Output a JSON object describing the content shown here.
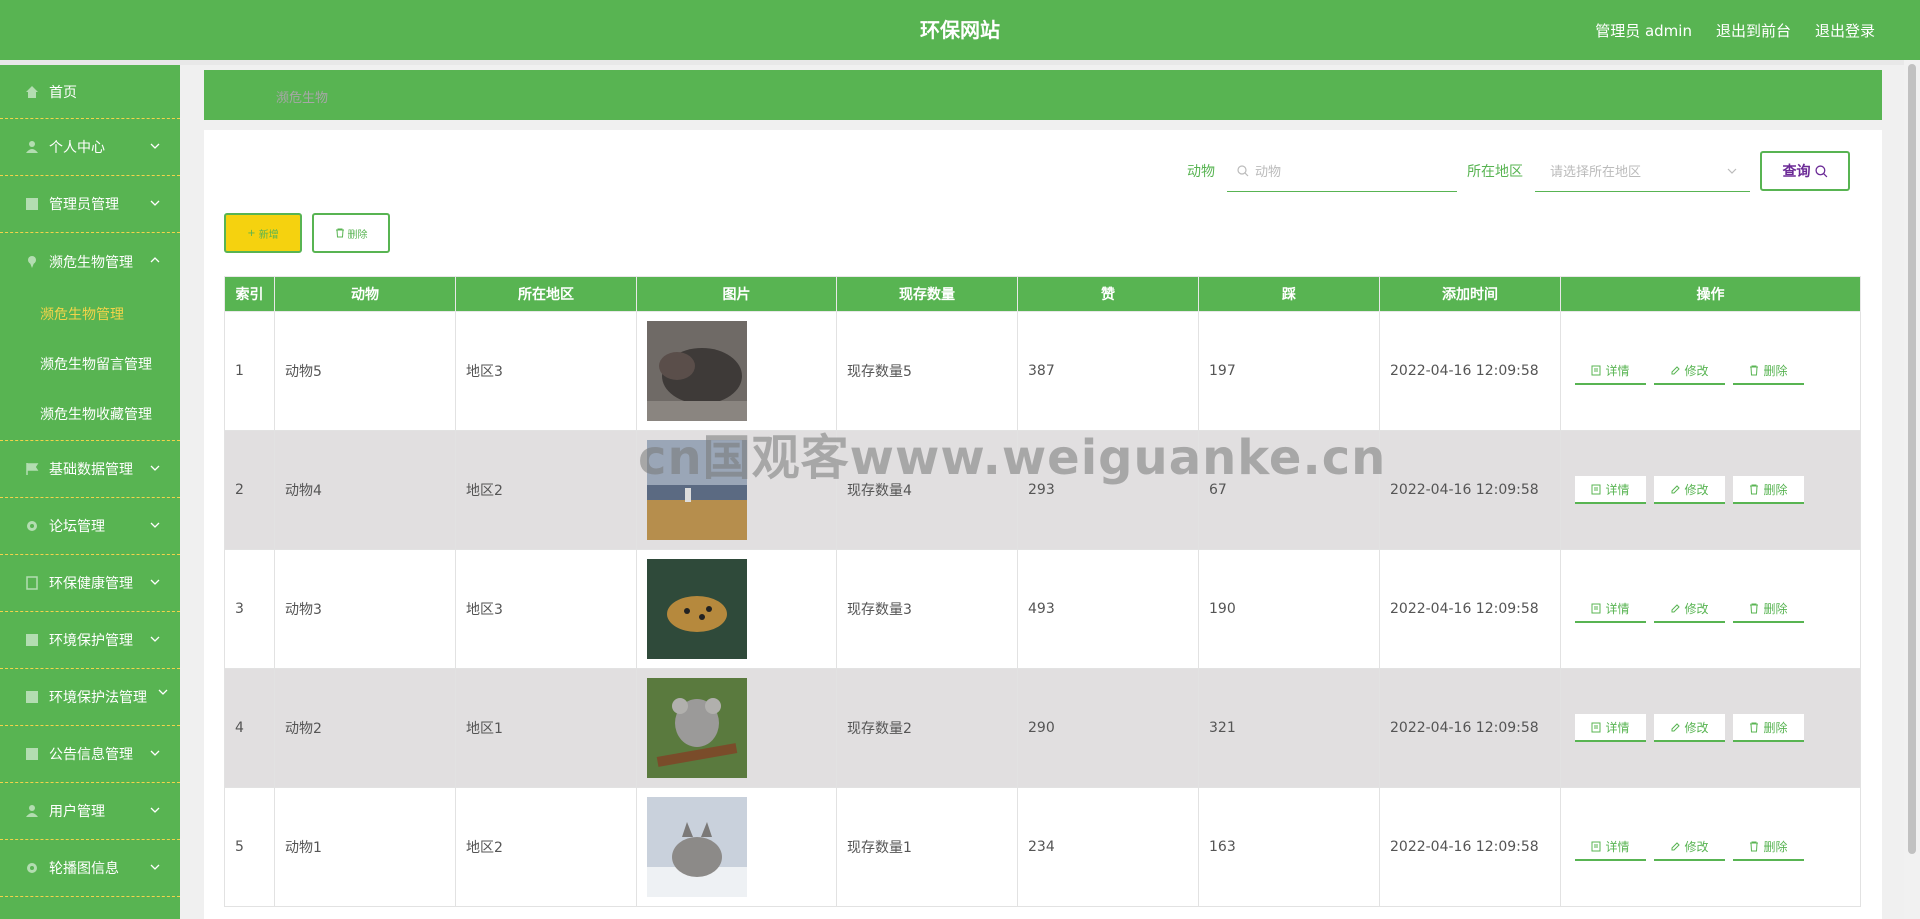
{
  "header": {
    "title": "环保网站",
    "admin_label": "管理员 admin",
    "to_front": "退出到前台",
    "logout": "退出登录"
  },
  "sidebar": {
    "items": [
      {
        "label": "首页",
        "icon": "home-icon"
      },
      {
        "label": "个人中心",
        "icon": "user-icon"
      },
      {
        "label": "管理员管理",
        "icon": "grid-icon"
      },
      {
        "label": "濒危生物管理",
        "icon": "pin-icon"
      },
      {
        "label": "基础数据管理",
        "icon": "flag-icon"
      },
      {
        "label": "论坛管理",
        "icon": "gear-icon"
      },
      {
        "label": "环保健康管理",
        "icon": "doc-icon"
      },
      {
        "label": "环境保护管理",
        "icon": "grid-icon"
      },
      {
        "label": "环境保护法管理",
        "icon": "grid-icon"
      },
      {
        "label": "公告信息管理",
        "icon": "grid-icon"
      },
      {
        "label": "用户管理",
        "icon": "user-icon"
      },
      {
        "label": "轮播图信息",
        "icon": "gear-icon"
      }
    ],
    "sub_items": [
      "濒危生物管理",
      "濒危生物留言管理",
      "濒危生物收藏管理"
    ]
  },
  "breadcrumb": "濒危生物",
  "search": {
    "animal_label": "动物",
    "animal_placeholder": "动物",
    "region_label": "所在地区",
    "region_placeholder": "请选择所在地区",
    "query_button": "查询"
  },
  "toolbar": {
    "add_label": "新增",
    "delete_label": "删除"
  },
  "table": {
    "headers": [
      "索引",
      "动物",
      "所在地区",
      "图片",
      "现存数量",
      "赞",
      "踩",
      "添加时间",
      "操作"
    ],
    "rows": [
      {
        "index": "1",
        "animal": "动物5",
        "region": "地区3",
        "count": "现存数量5",
        "likes": "387",
        "dislikes": "197",
        "time": "2022-04-16 12:09:58"
      },
      {
        "index": "2",
        "animal": "动物4",
        "region": "地区2",
        "count": "现存数量4",
        "likes": "293",
        "dislikes": "67",
        "time": "2022-04-16 12:09:58"
      },
      {
        "index": "3",
        "animal": "动物3",
        "region": "地区3",
        "count": "现存数量3",
        "likes": "493",
        "dislikes": "190",
        "time": "2022-04-16 12:09:58"
      },
      {
        "index": "4",
        "animal": "动物2",
        "region": "地区1",
        "count": "现存数量2",
        "likes": "290",
        "dislikes": "321",
        "time": "2022-04-16 12:09:58"
      },
      {
        "index": "5",
        "animal": "动物1",
        "region": "地区2",
        "count": "现存数量1",
        "likes": "234",
        "dislikes": "163",
        "time": "2022-04-16 12:09:58"
      }
    ],
    "op_detail": "详情",
    "op_edit": "修改",
    "op_delete": "删除"
  },
  "watermark": "cn国观客www.weiguanke.cn",
  "colors": {
    "primary": "#58b452",
    "accent_yellow": "#f3d34a",
    "row_alt": "#e1dfe0"
  }
}
